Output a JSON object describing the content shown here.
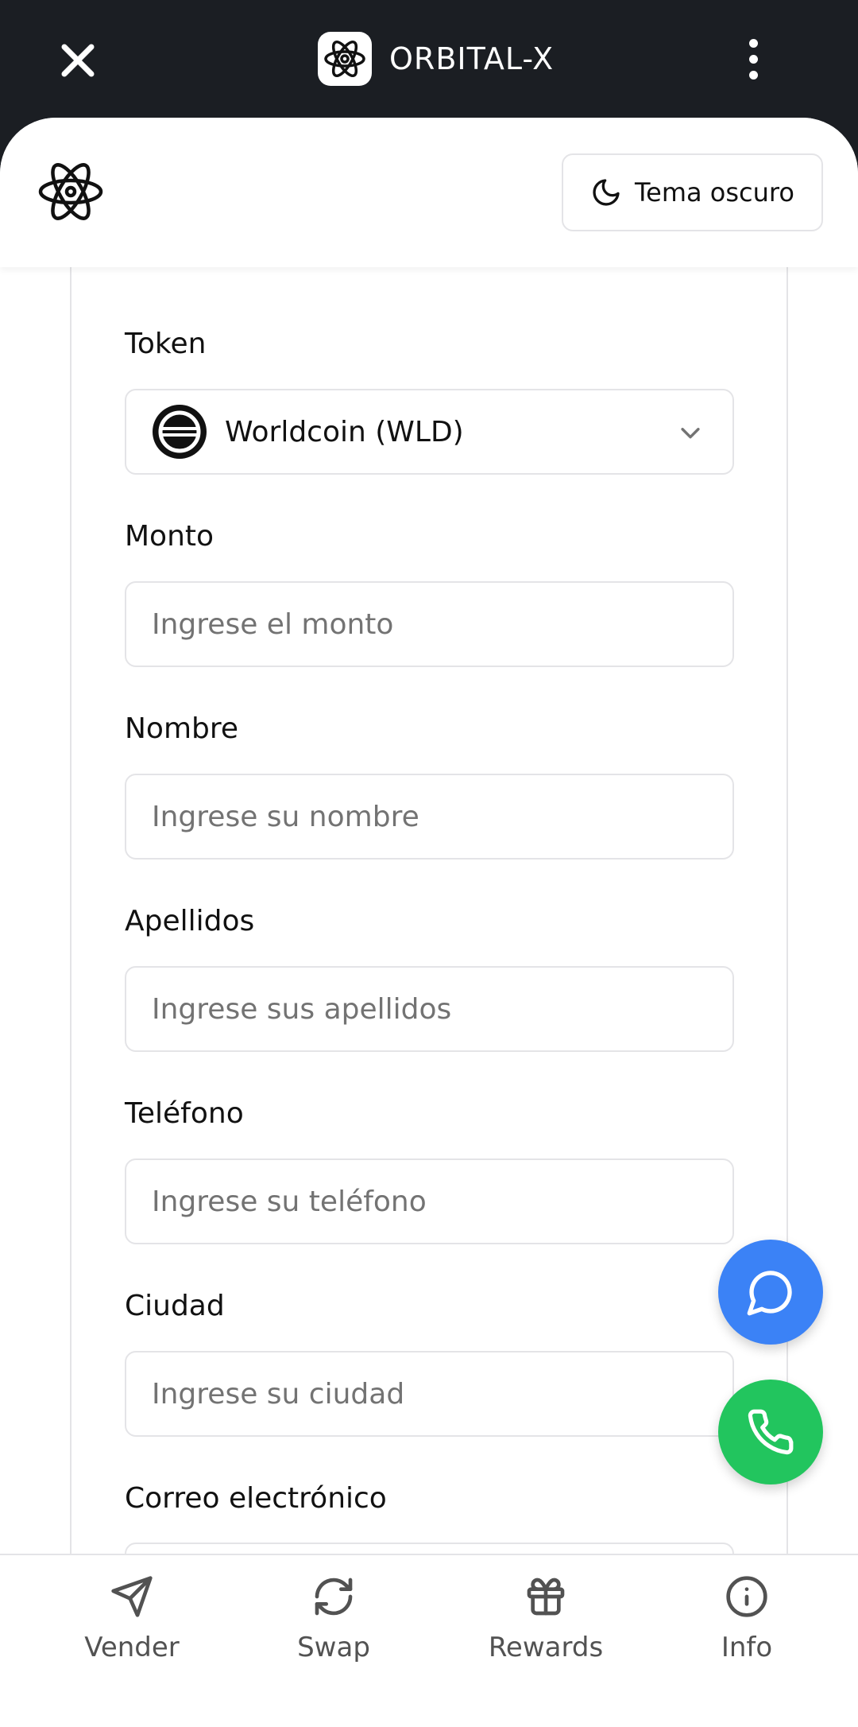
{
  "app_bar": {
    "title": "ORBITAL-X",
    "close_icon": "close-icon",
    "more_icon": "more-vertical-icon"
  },
  "header": {
    "logo_icon": "atom-icon",
    "theme_button_label": "Tema oscuro",
    "theme_icon": "moon-icon"
  },
  "form": {
    "token": {
      "label": "Token",
      "selected": "Worldcoin (WLD)",
      "icon": "worldcoin-icon"
    },
    "amount": {
      "label": "Monto",
      "placeholder": "Ingrese el monto"
    },
    "first_name": {
      "label": "Nombre",
      "placeholder": "Ingrese su nombre"
    },
    "last_name": {
      "label": "Apellidos",
      "placeholder": "Ingrese sus apellidos"
    },
    "phone": {
      "label": "Teléfono",
      "placeholder": "Ingrese su teléfono"
    },
    "city": {
      "label": "Ciudad",
      "placeholder": "Ingrese su ciudad"
    },
    "email": {
      "label": "Correo electrónico"
    }
  },
  "fabs": {
    "chat_icon": "chat-icon",
    "phone_icon": "phone-icon",
    "chat_color": "#3b82f6",
    "phone_color": "#22c55e"
  },
  "bottom_nav": {
    "items": [
      {
        "label": "Vender",
        "icon": "send-icon"
      },
      {
        "label": "Swap",
        "icon": "refresh-icon"
      },
      {
        "label": "Rewards",
        "icon": "gift-icon"
      },
      {
        "label": "Info",
        "icon": "info-icon"
      }
    ]
  }
}
